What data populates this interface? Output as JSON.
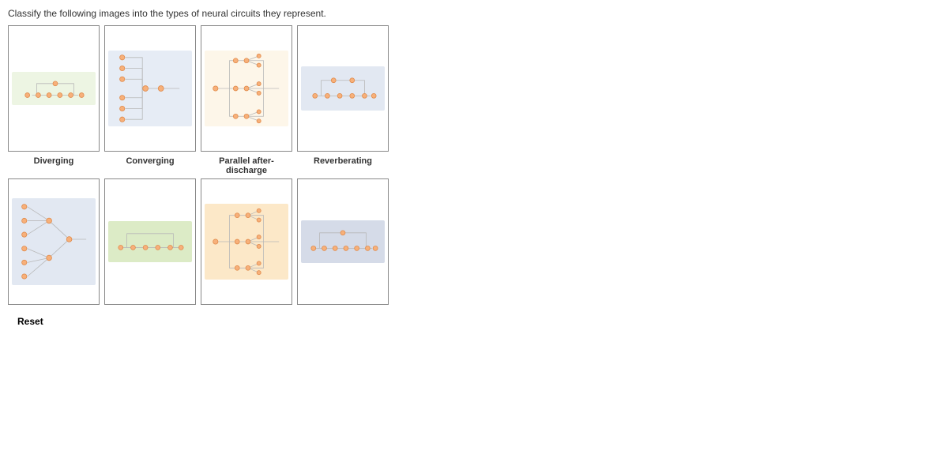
{
  "prompt": "Classify the following images into the types of neural circuits they represent.",
  "categories": [
    {
      "label": "Diverging"
    },
    {
      "label": "Converging"
    },
    {
      "label": "Parallel after-discharge"
    },
    {
      "label": "Reverberating"
    }
  ],
  "reset_label": "Reset",
  "thumbnails": {
    "top": [
      {
        "type": "reverberating",
        "bg": "bg-green"
      },
      {
        "type": "converging",
        "bg": "bg-blue"
      },
      {
        "type": "parallel",
        "bg": "bg-cream"
      },
      {
        "type": "reverberating",
        "bg": "bg-bluev"
      }
    ],
    "bottom": [
      {
        "type": "converging",
        "bg": "bg-bluev"
      },
      {
        "type": "reverberating",
        "bg": "bg-greenv"
      },
      {
        "type": "parallel",
        "bg": "bg-orangev"
      },
      {
        "type": "reverberating",
        "bg": "bg-slate"
      }
    ]
  },
  "colors": {
    "neuron_fill": "#f7b07a",
    "neuron_stroke": "#e08a4a",
    "line": "#b8b8b8"
  }
}
